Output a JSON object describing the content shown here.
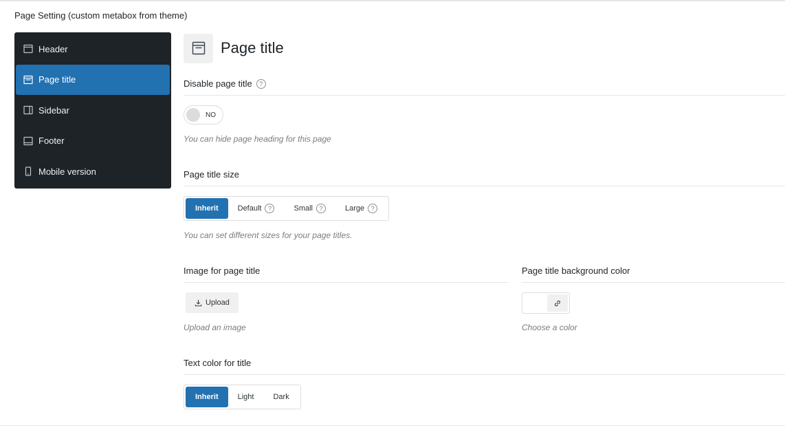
{
  "metabox": {
    "title": "Page Setting (custom metabox from theme)"
  },
  "sidebar": {
    "items": [
      {
        "label": "Header",
        "icon": "header-layout-icon"
      },
      {
        "label": "Page title",
        "icon": "page-title-layout-icon",
        "active": true
      },
      {
        "label": "Sidebar",
        "icon": "sidebar-layout-icon"
      },
      {
        "label": "Footer",
        "icon": "footer-layout-icon"
      },
      {
        "label": "Mobile version",
        "icon": "mobile-icon"
      }
    ]
  },
  "panel": {
    "title": "Page title",
    "icon": "page-title-layout-icon",
    "disable_title": {
      "label": "Disable page title",
      "help": "?",
      "toggle_value": "NO",
      "description": "You can hide page heading for this page"
    },
    "title_size": {
      "label": "Page title size",
      "options": [
        {
          "label": "Inherit",
          "selected": true
        },
        {
          "label": "Default",
          "help": "?"
        },
        {
          "label": "Small",
          "help": "?"
        },
        {
          "label": "Large",
          "help": "?"
        }
      ],
      "description": "You can set different sizes for your page titles."
    },
    "image": {
      "label": "Image for page title",
      "button": "Upload",
      "description": "Upload an image"
    },
    "bg_color": {
      "label": "Page title background color",
      "description": "Choose a color"
    },
    "text_color": {
      "label": "Text color for title",
      "options": [
        {
          "label": "Inherit",
          "selected": true
        },
        {
          "label": "Light"
        },
        {
          "label": "Dark"
        }
      ]
    }
  },
  "colors": {
    "accent": "#2271b1",
    "sidebar_bg": "#1d2327"
  }
}
